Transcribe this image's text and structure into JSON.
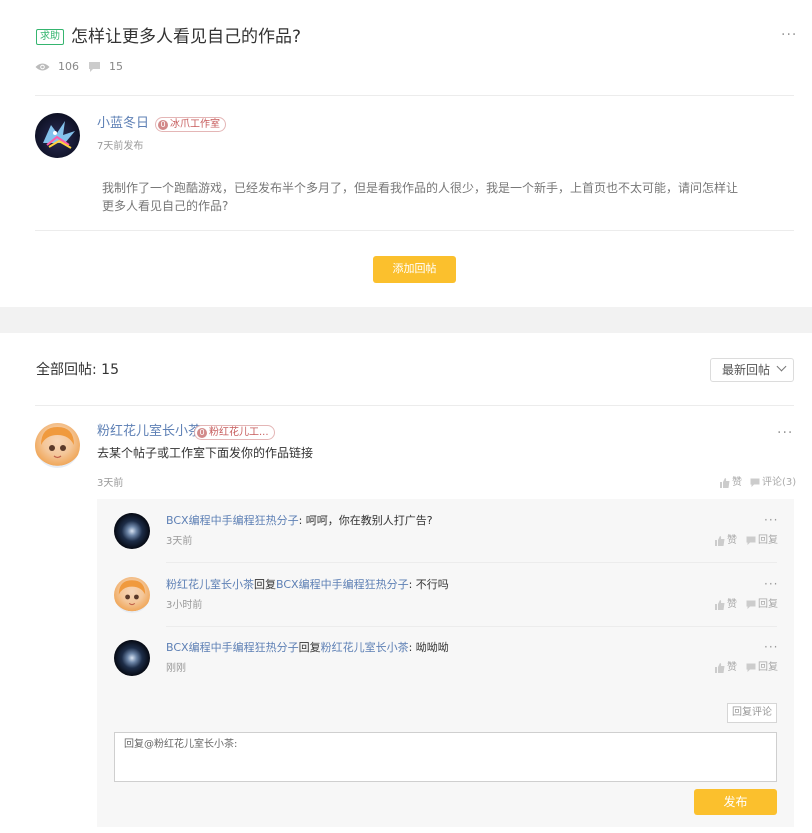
{
  "post": {
    "tag": "求助",
    "title": "怎样让更多人看见自己的作品?",
    "views": "106",
    "comments": "15",
    "author": "小蓝冬日",
    "studio": "冰爪工作室",
    "studio_level": "0",
    "time": "7天前发布",
    "content_line1": "我制作了一个跑酷游戏，已经发布半个多月了，但是看我作品的人很少，我是一个新手，上首页也不太可能，请问怎样让",
    "content_line2": "更多人看见自己的作品?",
    "add_reply_label": "添加回帖"
  },
  "replies_section": {
    "title": "全部回帖: 15",
    "sort_label": "最新回帖"
  },
  "reply": {
    "author": "粉红花儿室长小茶",
    "studio": "粉红花儿工...",
    "studio_level": "0",
    "text": "去某个帖子或工作室下面发你的作品链接",
    "time": "3天前",
    "like_label": "赞",
    "comment_label": "评论(3)"
  },
  "sub_replies": [
    {
      "author": "BCX编程中手编程狂热分子",
      "connector": "",
      "target": "",
      "sep": ": ",
      "text": "呵呵，你在教别人打广告?",
      "time": "3天前",
      "like": "赞",
      "reply": "回复"
    },
    {
      "author": "粉红花儿室长小茶",
      "connector": "回复",
      "target": "BCX编程中手编程狂热分子",
      "sep": ": ",
      "text": "不行吗",
      "time": "3小时前",
      "like": "赞",
      "reply": "回复"
    },
    {
      "author": "BCX编程中手编程狂热分子",
      "connector": "回复",
      "target": "粉红花儿室长小茶",
      "sep": ": ",
      "text": "呦呦呦",
      "time": "刚刚",
      "like": "赞",
      "reply": "回复"
    }
  ],
  "reply_form": {
    "reply_comment_label": "回复评论",
    "input_value": "回复@粉红花儿室长小茶:",
    "submit_label": "发布"
  },
  "icons": {
    "more": "more-dots-icon",
    "views": "eye-icon",
    "comments": "comment-icon",
    "like": "thumb-up-icon",
    "comment_small": "comment-icon"
  },
  "colors": {
    "accent_yellow": "#fbc02d",
    "link_blue": "#5e80b5",
    "tag_green": "#35b56f"
  }
}
